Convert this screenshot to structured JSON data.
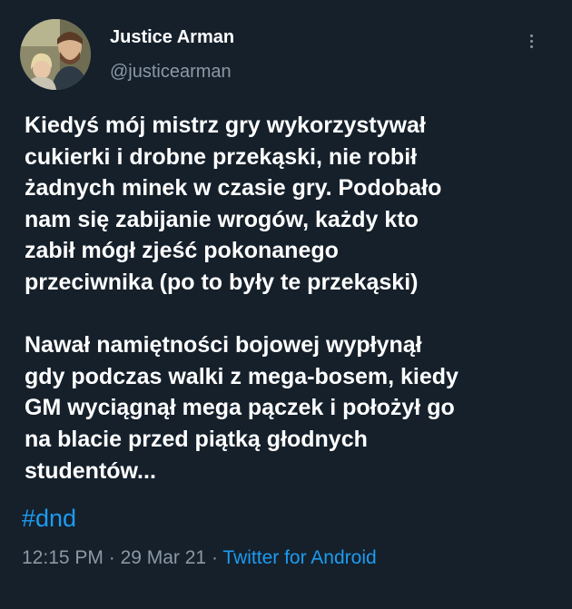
{
  "author": {
    "display_name": "Justice Arman",
    "handle": "@justicearman",
    "avatar_icon": "profile-photo-avatar"
  },
  "more_icon": "more-vertical-icon",
  "tweet": {
    "paragraph1": [
      "Kiedyś mój mistrz gry wykorzystywał",
      "cukierki i drobne przekąski, nie robił",
      "żadnych minek w czasie gry. Podobało",
      "nam się zabijanie wrogów, każdy kto",
      "zabił mógł zjeść pokonanego",
      "przeciwnika (po to były te przekąski)"
    ],
    "paragraph2": [
      "Nawał namiętności bojowej wypłynął",
      "gdy podczas walki z mega-bosem, kiedy",
      "GM wyciągnął mega pączek i położył go",
      "na blacie przed piątką głodnych",
      "studentów..."
    ],
    "hashtag": "#dnd"
  },
  "meta": {
    "time": "12:15 PM",
    "separator1": " · ",
    "date": "29 Mar 21",
    "separator2": " · ",
    "source": "Twitter for Android"
  },
  "colors": {
    "background": "#15202b",
    "text": "#ffffff",
    "secondary": "#8b98a5",
    "accent": "#1d9bf0"
  }
}
